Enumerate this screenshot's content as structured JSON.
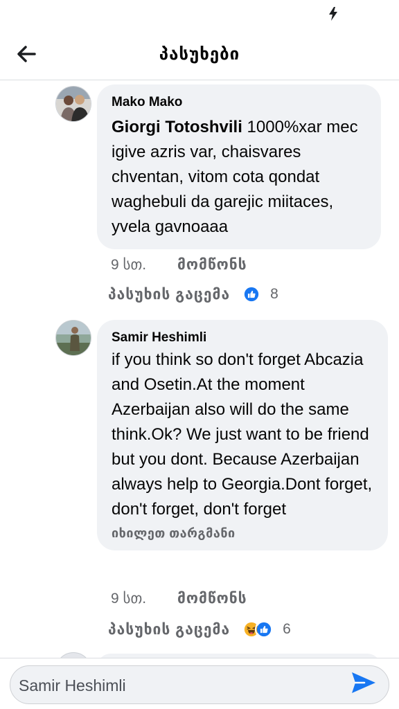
{
  "header": {
    "title": "პასუხები"
  },
  "comments": [
    {
      "author": "Mako Mako",
      "tag": "Giorgi Totoshvili",
      "text": " 1000%xar mec igive azris var, chaisvares chventan, vitom cota qondat waghebuli da garejic miitaces, yvela gavnoaaa",
      "time": "9 სთ.",
      "like_label": "მომწონს",
      "reply_label": "პასუხის გაცემა",
      "reaction_icons": [
        "like-reaction-icon"
      ],
      "reaction_count": "8"
    },
    {
      "author": "Samir Heshimli",
      "text": "if you think so don't forget Abcazia and Osetin.At the moment Azerbaijan also will do the same think.Ok? We just want to be friend but you dont. Because Azerbaijan always help to Georgia.Dont forget, don't forget, don't forget",
      "translate_label": "იხილეთ თარგმანი",
      "time": "9 სთ.",
      "like_label": "მომწონს",
      "reply_label": "პასუხის გაცემა",
      "reaction_icons": [
        "haha-reaction-icon",
        "like-reaction-icon"
      ],
      "reaction_count": "6"
    }
  ],
  "composer": {
    "value": "Samir Heshimli",
    "placeholder": ""
  },
  "colors": {
    "accent": "#1877f2",
    "bubble": "#f0f2f5",
    "secondary_text": "#65676b",
    "haha": "#f7b125"
  },
  "icons": {
    "back": "back-arrow-icon",
    "send": "send-icon",
    "status": "charging-bolt-icon"
  }
}
